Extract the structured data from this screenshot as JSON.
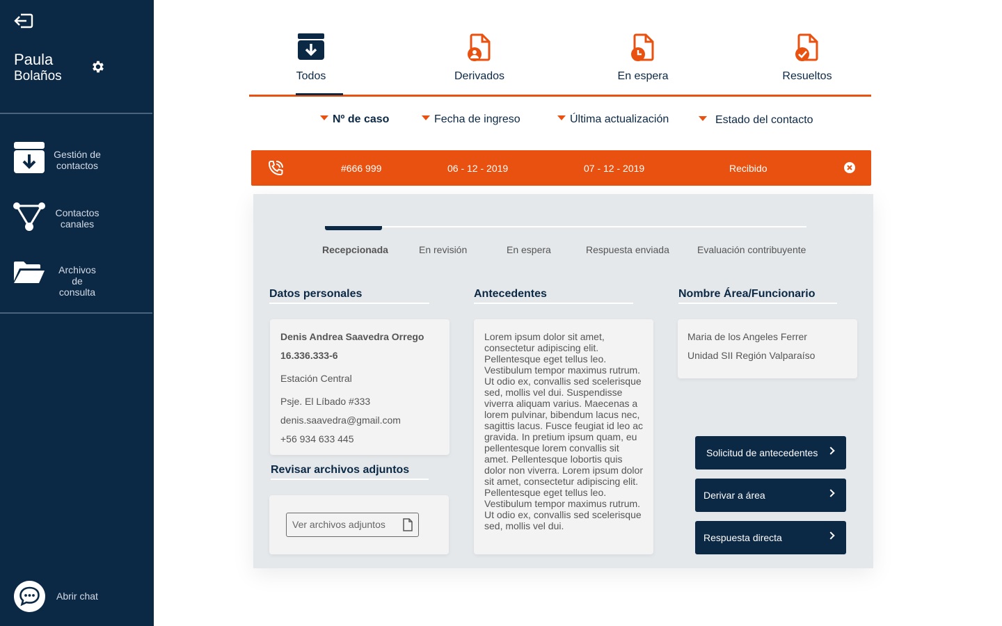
{
  "sidebar": {
    "user_first": "Paula",
    "user_last": "Bolaños",
    "items": [
      {
        "label": "Gestión de contactos",
        "icon": "archive-icon"
      },
      {
        "label": "Contactos canales",
        "icon": "network-icon"
      },
      {
        "label": "Archivos de consulta",
        "icon": "folder-open-icon"
      }
    ],
    "chat_label": "Abrir chat"
  },
  "tabs": [
    {
      "label": "Todos",
      "icon": "archive-download-icon"
    },
    {
      "label": "Derivados",
      "icon": "document-user-icon"
    },
    {
      "label": "En espera",
      "icon": "document-clock-icon"
    },
    {
      "label": "Resueltos",
      "icon": "document-check-icon"
    }
  ],
  "active_tab": "Todos",
  "sort": [
    {
      "label": "Nº de caso"
    },
    {
      "label": "Fecha de  ingreso"
    },
    {
      "label": "Última actualización"
    },
    {
      "label": "Estado del contacto"
    }
  ],
  "case": {
    "number": "#666 999",
    "ingreso": "06 - 12 - 2019",
    "actualizacion": "07 - 12 - 2019",
    "estado": "Recibido"
  },
  "steps": [
    "Recepcionada",
    "En revisión",
    "En espera",
    "Respuesta enviada",
    "Evaluación contribuyente"
  ],
  "active_step": "Recepcionada",
  "personal": {
    "title": "Datos  personales",
    "name": "Denis Andrea Saavedra Orrego",
    "rut": "16.336.333-6",
    "station": "Estación Central",
    "address": "Psje. El Líbado #333",
    "email": "denis.saavedra@gmail.com",
    "phone": "+56 934 633 445"
  },
  "attachments": {
    "title": "Revisar archivos adjuntos",
    "button": "Ver archivos adjuntos"
  },
  "antecedentes": {
    "title": "Antecedentes",
    "text": "Lorem ipsum dolor sit amet, consectetur adipiscing elit. Pellentesque eget tellus leo. Vestibulum tempor maximus rutrum. Ut odio ex, convallis sed scelerisque sed, mollis vel dui. Suspendisse viverra aliquam varius. Maecenas a lorem pulvinar, bibendum lacus nec, sagittis lacus. Fusce feugiat id leo ac gravida. In pretium ipsum quam, eu pellentesque lorem convallis sit amet. Pellentesque lobortis quis dolor non viverra.  Lorem ipsum dolor sit amet, consectetur adipiscing elit. Pellentesque eget tellus leo. Vestibulum tempor maximus rutrum. Ut odio ex, convallis sed scelerisque sed, mollis vel dui."
  },
  "area": {
    "title": "Nombre Área/Funcionario",
    "funcionario": "Maria de los Angeles Ferrer",
    "unidad": "Unidad SII Región Valparaíso"
  },
  "actions": [
    {
      "label": "Solicitud de antecedentes"
    },
    {
      "label": "Derivar a área"
    },
    {
      "label": "Respuesta directa"
    }
  ],
  "colors": {
    "navy": "#0b2845",
    "orange": "#e8510f",
    "panel": "#e4e8eb"
  }
}
